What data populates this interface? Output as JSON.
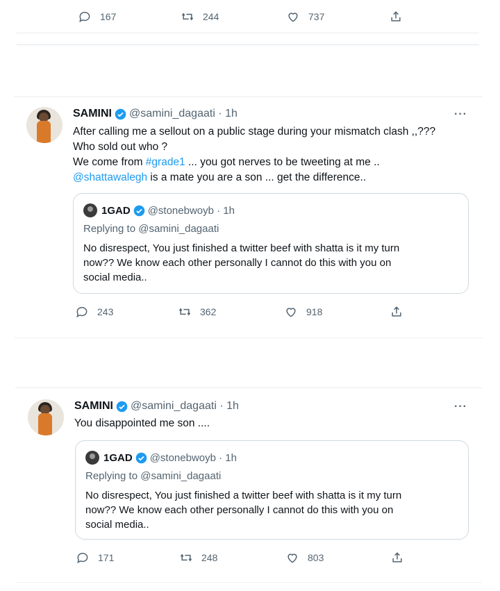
{
  "tweet0": {
    "actions": {
      "replies": "167",
      "retweets": "244",
      "likes": "737"
    }
  },
  "tweet1": {
    "name": "SAMINI",
    "handle_time": "@samini_dagaati · 1h",
    "more": "···",
    "line1": "After calling me a sellout on a public stage during your mismatch clash ,,???",
    "line2": "Who sold out who ?",
    "line3_a": "We come from ",
    "line3_link": "#grade1",
    "line3_b": " ... you got nerves to be tweeting at me ..",
    "line4_link": "@shattawalegh",
    "line4_b": " is a mate you are a son ... get the difference..",
    "quote": {
      "name": "1GAD",
      "handle_time": "@stonebwoyb · 1h",
      "replying": "Replying to @samini_dagaati",
      "text1": "No disrespect, You  just finished a twitter beef with shatta is it my turn",
      "text2": "now?? We know each other personally I cannot do this with you on",
      "text3": "social media.."
    },
    "actions": {
      "replies": "243",
      "retweets": "362",
      "likes": "918"
    }
  },
  "tweet2": {
    "name": "SAMINI",
    "handle_time": "@samini_dagaati · 1h",
    "more": "···",
    "line1": "You disappointed me son ....",
    "quote": {
      "name": "1GAD",
      "handle_time": "@stonebwoyb · 1h",
      "replying": "Replying to @samini_dagaati",
      "text1": "No disrespect, You  just finished a twitter beef with shatta is it my turn",
      "text2": "now?? We know each other personally I cannot do this with you on",
      "text3": "social media.."
    },
    "actions": {
      "replies": "171",
      "retweets": "248",
      "likes": "803"
    }
  },
  "colors": {
    "link": "#1d9bf0",
    "muted": "#536471",
    "border": "#cfd9de"
  }
}
